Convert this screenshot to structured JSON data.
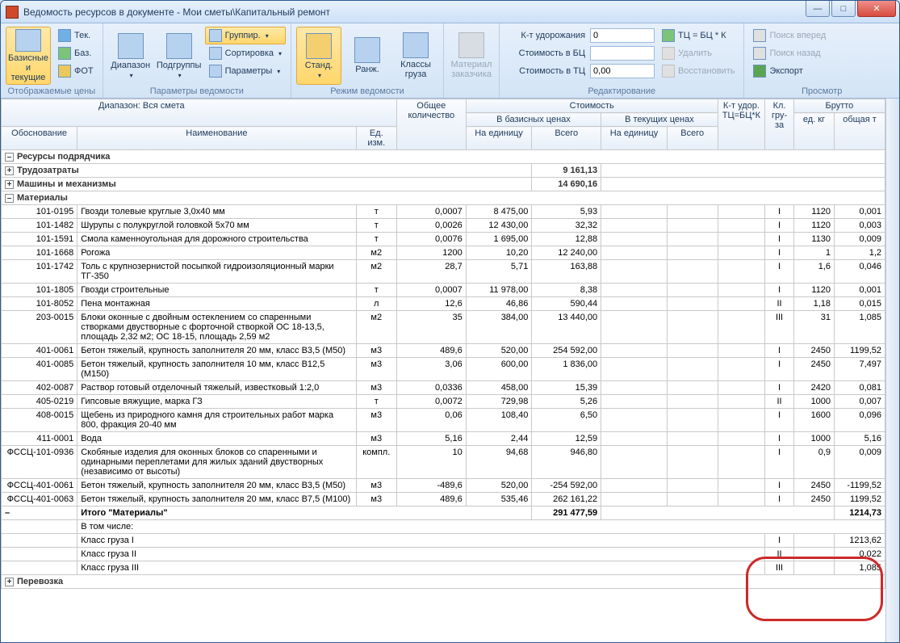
{
  "window": {
    "title": "Ведомость ресурсов в документе - Мои сметы\\Капитальный ремонт"
  },
  "ribbon": {
    "g1": {
      "label": "Отображаемые цены",
      "basic_current": "Базисные и текущие",
      "tek": "Тек.",
      "baz": "Баз.",
      "fot": "ФОТ"
    },
    "g2": {
      "label": "Параметры ведомости",
      "range": "Диапазон",
      "subgroups": "Подгруппы",
      "group": "Группир.",
      "sort": "Сортировка",
      "params": "Параметры"
    },
    "g3": {
      "label": "Режим ведомости",
      "standard": "Станд.",
      "rank": "Ранж.",
      "classes": "Классы груза"
    },
    "g4": {
      "label": "",
      "customer_mat": "Материал заказчика"
    },
    "g5": {
      "label": "Редактирование",
      "kt_label": "К-т удорожания",
      "kt_val": "0",
      "cost_bc_label": "Стоимость в БЦ",
      "cost_bc_val": "",
      "cost_tc_label": "Стоимость в ТЦ",
      "cost_tc_val": "0,00",
      "formula": "ТЦ = БЦ * К",
      "delete": "Удалить",
      "restore": "Восстановить"
    },
    "g6": {
      "label": "Просмотр",
      "find_fwd": "Поиск вперед",
      "find_back": "Поиск назад",
      "export": "Экспорт"
    }
  },
  "headers": {
    "range_label": "Диапазон:",
    "range_value": "Вся смета",
    "obo": "Обоснование",
    "name": "Наименование",
    "edizm": "Ед. изм.",
    "total_qty": "Общее количество",
    "cost": "Стоимость",
    "bp": "В базисных ценах",
    "cp": "В текущих ценах",
    "unit": "На единицу",
    "total": "Всего",
    "kt": "К-т удор. ТЦ=БЦ*К",
    "kl": "Кл. гру-за",
    "brutto": "Брутто",
    "bkg": "ед. кг",
    "bt": "общая т"
  },
  "groups": {
    "contractor": "Ресурсы подрядчика",
    "labor": "Трудозатраты",
    "labor_total": "9 161,13",
    "machines": "Машины и механизмы",
    "machines_total": "14 690,16",
    "materials": "Материалы",
    "materials_total_label": "Итого \"Материалы\"",
    "materials_total": "291 477,59",
    "materials_bt": "1214,73",
    "including": "В том числе:",
    "class1": "Класс груза I",
    "class1_kl": "I",
    "class1_bt": "1213,62",
    "class2": "Класс груза II",
    "class2_kl": "II",
    "class2_bt": "0,022",
    "class3": "Класс груза III",
    "class3_kl": "III",
    "class3_bt": "1,085",
    "transport": "Перевозка"
  },
  "rows": [
    {
      "obo": "101-0195",
      "name": "Гвозди толевые круглые 3,0х40 мм",
      "ed": "т",
      "qty": "0,0007",
      "bpu": "8 475,00",
      "bpt": "5,93",
      "kl": "I",
      "bkg": "1120",
      "bt": "0,001"
    },
    {
      "obo": "101-1482",
      "name": "Шурупы с полукруглой головкой 5х70 мм",
      "ed": "т",
      "qty": "0,0026",
      "bpu": "12 430,00",
      "bpt": "32,32",
      "kl": "I",
      "bkg": "1120",
      "bt": "0,003"
    },
    {
      "obo": "101-1591",
      "name": "Смола каменноугольная для дорожного строительства",
      "ed": "т",
      "qty": "0,0076",
      "bpu": "1 695,00",
      "bpt": "12,88",
      "kl": "I",
      "bkg": "1130",
      "bt": "0,009"
    },
    {
      "obo": "101-1668",
      "name": "Рогожа",
      "ed": "м2",
      "qty": "1200",
      "bpu": "10,20",
      "bpt": "12 240,00",
      "kl": "I",
      "bkg": "1",
      "bt": "1,2"
    },
    {
      "obo": "101-1742",
      "name": "Толь с крупнозернистой посыпкой гидроизоляционный марки ТГ-350",
      "ed": "м2",
      "qty": "28,7",
      "bpu": "5,71",
      "bpt": "163,88",
      "kl": "I",
      "bkg": "1,6",
      "bt": "0,046"
    },
    {
      "obo": "101-1805",
      "name": "Гвозди строительные",
      "ed": "т",
      "qty": "0,0007",
      "bpu": "11 978,00",
      "bpt": "8,38",
      "kl": "I",
      "bkg": "1120",
      "bt": "0,001"
    },
    {
      "obo": "101-8052",
      "name": "Пена монтажная",
      "ed": "л",
      "qty": "12,6",
      "bpu": "46,86",
      "bpt": "590,44",
      "kl": "II",
      "bkg": "1,18",
      "bt": "0,015"
    },
    {
      "obo": "203-0015",
      "name": "Блоки оконные с двойным остеклением со спаренными створками двустворные с форточной створкой ОС 18-13,5, площадь 2,32 м2; ОС 18-15, площадь 2,59 м2",
      "ed": "м2",
      "qty": "35",
      "bpu": "384,00",
      "bpt": "13 440,00",
      "kl": "III",
      "bkg": "31",
      "bt": "1,085"
    },
    {
      "obo": "401-0061",
      "name": "Бетон тяжелый, крупность заполнителя 20 мм, класс В3,5 (М50)",
      "ed": "м3",
      "qty": "489,6",
      "bpu": "520,00",
      "bpt": "254 592,00",
      "kl": "I",
      "bkg": "2450",
      "bt": "1199,52"
    },
    {
      "obo": "401-0085",
      "name": "Бетон тяжелый, крупность заполнителя 10 мм, класс В12,5 (М150)",
      "ed": "м3",
      "qty": "3,06",
      "bpu": "600,00",
      "bpt": "1 836,00",
      "kl": "I",
      "bkg": "2450",
      "bt": "7,497"
    },
    {
      "obo": "402-0087",
      "name": "Раствор готовый отделочный тяжелый, известковый 1:2,0",
      "ed": "м3",
      "qty": "0,0336",
      "bpu": "458,00",
      "bpt": "15,39",
      "kl": "I",
      "bkg": "2420",
      "bt": "0,081"
    },
    {
      "obo": "405-0219",
      "name": "Гипсовые вяжущие, марка ГЗ",
      "ed": "т",
      "qty": "0,0072",
      "bpu": "729,98",
      "bpt": "5,26",
      "kl": "II",
      "bkg": "1000",
      "bt": "0,007"
    },
    {
      "obo": "408-0015",
      "name": "Щебень из природного камня для строительных работ марка 800, фракция 20-40 мм",
      "ed": "м3",
      "qty": "0,06",
      "bpu": "108,40",
      "bpt": "6,50",
      "kl": "I",
      "bkg": "1600",
      "bt": "0,096"
    },
    {
      "obo": "411-0001",
      "name": "Вода",
      "ed": "м3",
      "qty": "5,16",
      "bpu": "2,44",
      "bpt": "12,59",
      "kl": "I",
      "bkg": "1000",
      "bt": "5,16"
    },
    {
      "obo": "ФССЦ-101-0936",
      "name": "Скобяные изделия для оконных блоков со спаренными и одинарными переплетами для жилых зданий двустворных (независимо от высоты)",
      "ed": "компл.",
      "qty": "10",
      "bpu": "94,68",
      "bpt": "946,80",
      "kl": "I",
      "bkg": "0,9",
      "bt": "0,009"
    },
    {
      "obo": "ФССЦ-401-0061",
      "name": "Бетон тяжелый, крупность заполнителя 20 мм, класс В3,5 (М50)",
      "ed": "м3",
      "qty": "-489,6",
      "bpu": "520,00",
      "bpt": "-254 592,00",
      "kl": "I",
      "bkg": "2450",
      "bt": "-1199,52"
    },
    {
      "obo": "ФССЦ-401-0063",
      "name": "Бетон тяжелый, крупность заполнителя 20 мм, класс В7,5 (М100)",
      "ed": "м3",
      "qty": "489,6",
      "bpu": "535,46",
      "bpt": "262 161,22",
      "kl": "I",
      "bkg": "2450",
      "bt": "1199,52"
    }
  ]
}
